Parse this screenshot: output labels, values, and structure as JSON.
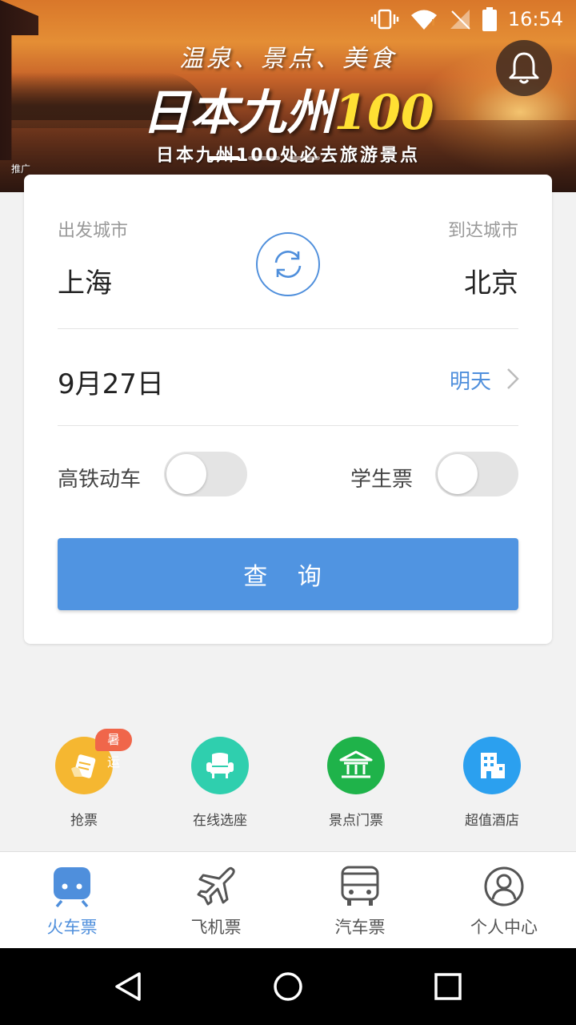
{
  "status_bar": {
    "time": "16:54"
  },
  "banner": {
    "tagline": "温泉、景点、美食",
    "headline_text": "日本九州",
    "headline_number": "100",
    "subline": "日本九州100处必去旅游景点",
    "promo_label": "推广"
  },
  "search_form": {
    "from_label": "出发城市",
    "from_city": "上海",
    "to_label": "到达城市",
    "to_city": "北京",
    "date": "9月27日",
    "date_hint": "明天",
    "option_high_speed": "高铁动车",
    "option_student": "学生票",
    "high_speed_enabled": false,
    "student_enabled": false,
    "search_button": "查 询"
  },
  "quick_actions": [
    {
      "label": "抢票",
      "badge": "暑运",
      "icon": "ticket-grab-icon",
      "color": "#f5b731"
    },
    {
      "label": "在线选座",
      "icon": "seat-icon",
      "color": "#2fcfae"
    },
    {
      "label": "景点门票",
      "icon": "attraction-icon",
      "color": "#1fb34a"
    },
    {
      "label": "超值酒店",
      "icon": "hotel-icon",
      "color": "#2ba0ef"
    }
  ],
  "tabs": [
    {
      "label": "火车票",
      "icon": "train-icon",
      "active": true
    },
    {
      "label": "飞机票",
      "icon": "plane-icon",
      "active": false
    },
    {
      "label": "汽车票",
      "icon": "bus-icon",
      "active": false
    },
    {
      "label": "个人中心",
      "icon": "user-icon",
      "active": false
    }
  ],
  "colors": {
    "accent": "#5094e1",
    "badge": "#f0664a"
  }
}
